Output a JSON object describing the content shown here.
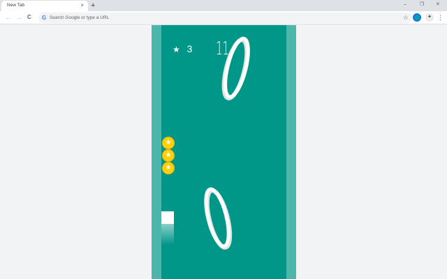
{
  "browser": {
    "tab_title": "New Tab",
    "tab_close": "×",
    "new_tab": "+",
    "controls": {
      "minimize": "–",
      "restore": "❐",
      "close": "✕"
    },
    "nav": {
      "back": "←",
      "forward": "→",
      "reload": "C"
    },
    "omnibox": {
      "placeholder": "Search Google or type a URL",
      "g_glyph": "G",
      "star_glyph": "☆"
    },
    "menu_glyph": "⋮",
    "ext_glyph": "✦"
  },
  "game": {
    "score": "11",
    "stars_count": "3",
    "star_glyph": "★",
    "coin_glyph": "★",
    "coins_visible": 3,
    "colors": {
      "background": "#009688",
      "rails": "#4db6ac",
      "coin": "#ffcf0a",
      "player": "#ffffff"
    }
  }
}
